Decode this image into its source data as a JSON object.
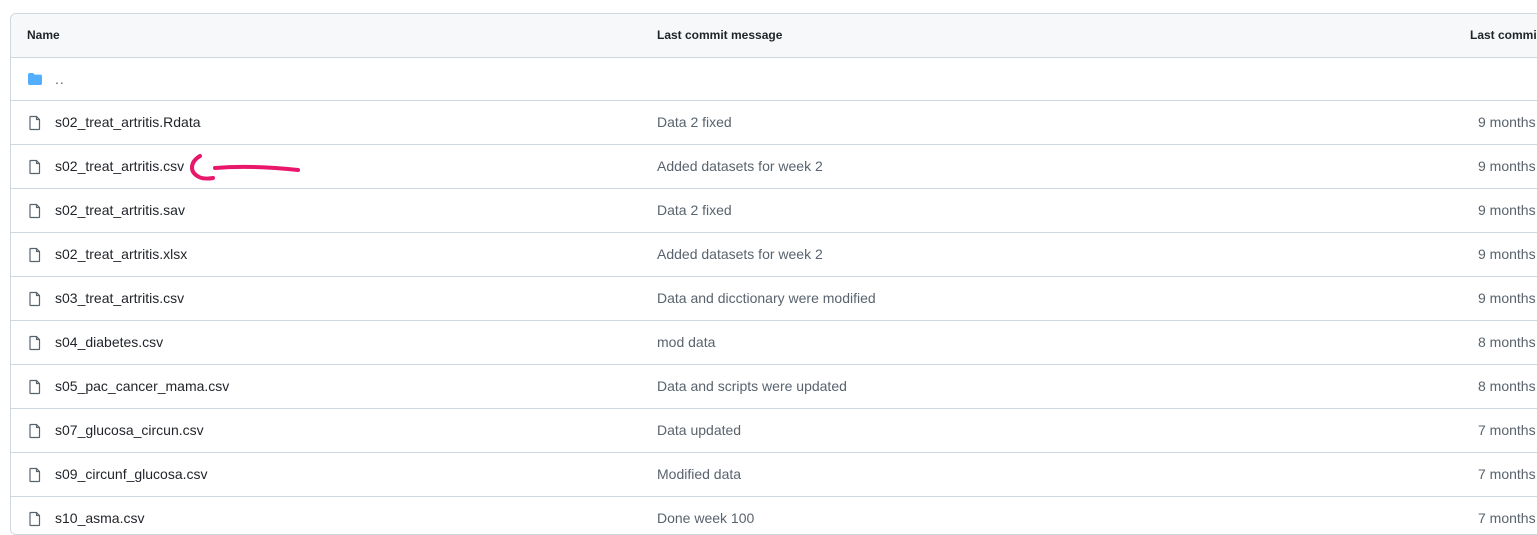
{
  "table": {
    "headers": {
      "name": "Name",
      "message": "Last commit message",
      "date": "Last commi"
    },
    "parent_dir": "..",
    "rows": [
      {
        "name": "s02_treat_artritis.Rdata",
        "message": "Data 2 fixed",
        "date": "9 months"
      },
      {
        "name": "s02_treat_artritis.csv",
        "message": "Added datasets for week 2",
        "date": "9 months"
      },
      {
        "name": "s02_treat_artritis.sav",
        "message": "Data 2 fixed",
        "date": "9 months"
      },
      {
        "name": "s02_treat_artritis.xlsx",
        "message": "Added datasets for week 2",
        "date": "9 months"
      },
      {
        "name": "s03_treat_artritis.csv",
        "message": "Data and dicctionary were modified",
        "date": "9 months"
      },
      {
        "name": "s04_diabetes.csv",
        "message": "mod data",
        "date": "8 months"
      },
      {
        "name": "s05_pac_cancer_mama.csv",
        "message": "Data and scripts were updated",
        "date": "8 months"
      },
      {
        "name": "s07_glucosa_circun.csv",
        "message": "Data updated",
        "date": "7 months"
      },
      {
        "name": "s09_circunf_glucosa.csv",
        "message": "Modified data",
        "date": "7 months"
      },
      {
        "name": "s10_asma.csv",
        "message": "Done week 100",
        "date": "7 months"
      }
    ]
  },
  "icons": {
    "file": "file-icon",
    "folder": "folder-icon"
  },
  "colors": {
    "folder": "#54aeff",
    "annotation": "#e8176b",
    "border": "#d0d7de",
    "header_bg": "#f6f8fa"
  }
}
